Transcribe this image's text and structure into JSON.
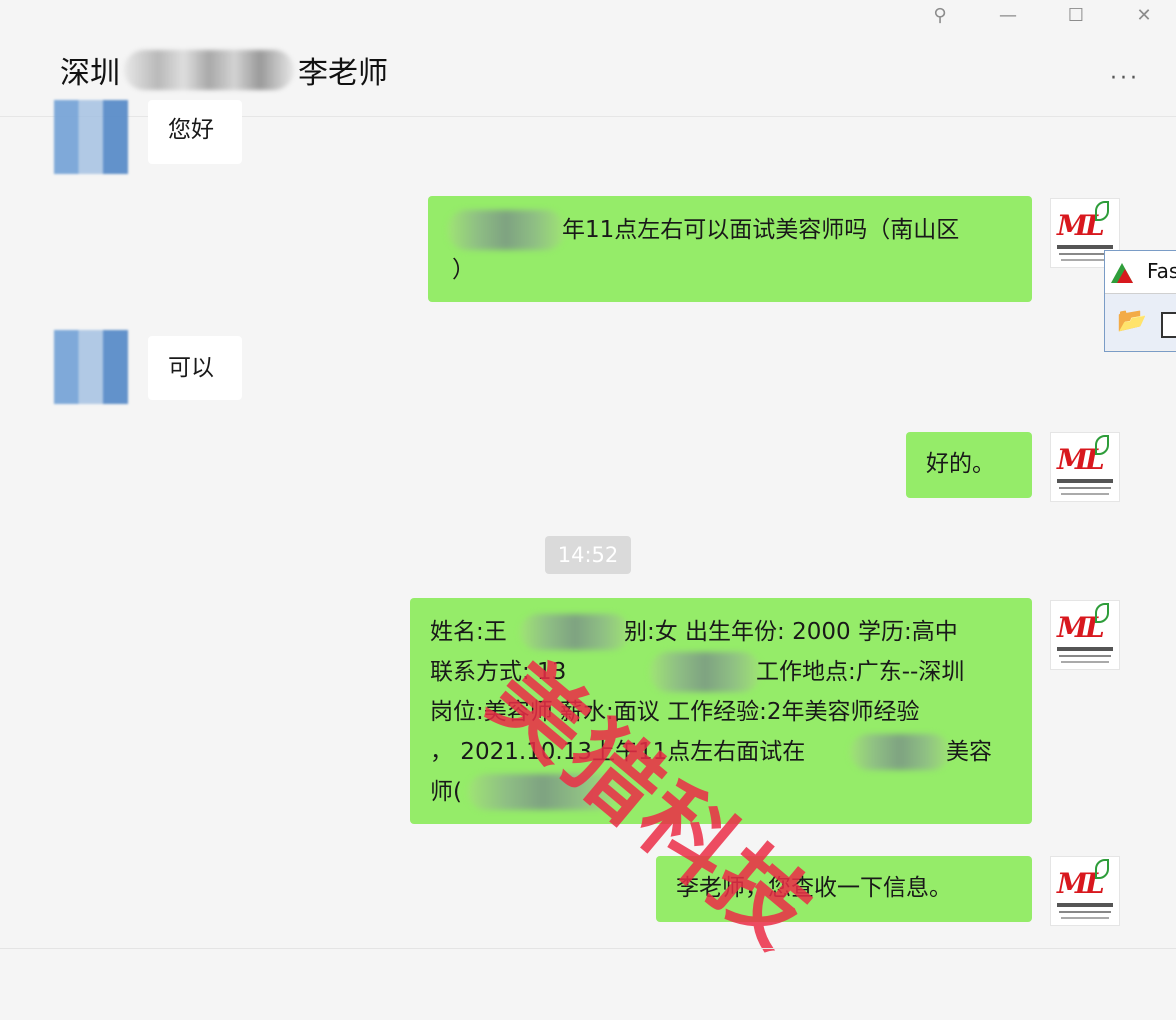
{
  "window": {
    "title_prefix": "深圳",
    "title_suffix": "李老师",
    "controls": {
      "pin": "⚲",
      "minimize": "—",
      "maximize": "☐",
      "close": "✕"
    },
    "more": "···"
  },
  "messages": [
    {
      "side": "in",
      "text": "您好"
    },
    {
      "side": "out",
      "text_line1": "年11点左右可以面试美容师吗（南山区",
      "text_line2": "）"
    },
    {
      "side": "in",
      "text": "可以"
    },
    {
      "side": "out",
      "text": "好的。"
    },
    {
      "side": "time",
      "text": "14:52"
    },
    {
      "side": "out",
      "lines": [
        "姓名:王",
        "别:女 出生年份: 2000 学历:高中",
        "联系方式: 13",
        "工作地点:广东--深圳",
        "岗位:美容师 薪水:面议 工作经验:2年美容师经验",
        "， 2021.10.13上午11点左右面试在",
        "美容",
        "师("
      ]
    },
    {
      "side": "out",
      "text": "李老师，您查收一下信息。"
    }
  ],
  "watermark": "美猎科技",
  "fast_window": {
    "title": "Fas",
    "icon_open": "📂"
  },
  "avatar_logo": {
    "mark": "ML"
  }
}
